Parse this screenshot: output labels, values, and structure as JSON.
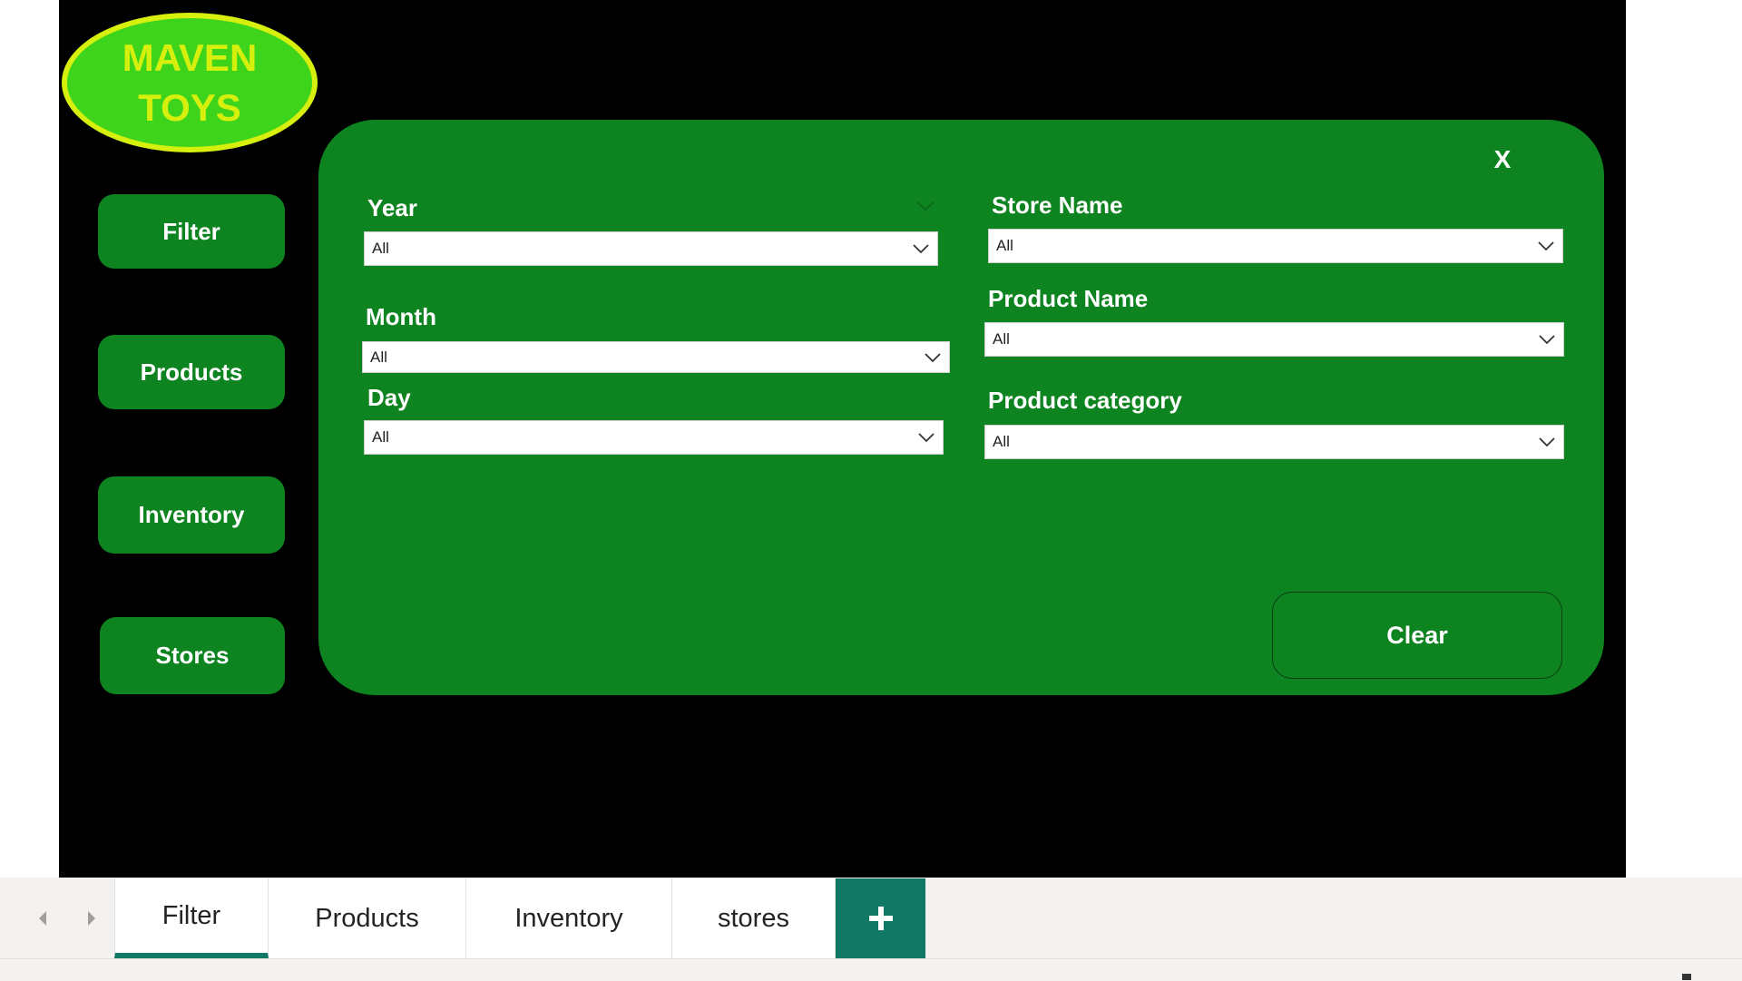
{
  "logo": {
    "line1": "MAVEN",
    "line2": "TOYS"
  },
  "nav": {
    "filter_label": "Filter",
    "products_label": "Products",
    "inventory_label": "Inventory",
    "stores_label": "Stores"
  },
  "panel": {
    "close_label": "X",
    "clear_label": "Clear"
  },
  "slicers": {
    "year": {
      "label": "Year",
      "value": "All"
    },
    "month": {
      "label": "Month",
      "value": "All"
    },
    "day": {
      "label": "Day",
      "value": "All"
    },
    "store_name": {
      "label": "Store Name",
      "value": "All"
    },
    "product_name": {
      "label": "Product Name",
      "value": "All"
    },
    "product_category": {
      "label": "Product category",
      "value": "All"
    }
  },
  "tabs": [
    {
      "label": "Filter",
      "active": true
    },
    {
      "label": "Products",
      "active": false
    },
    {
      "label": "Inventory",
      "active": false
    },
    {
      "label": "stores",
      "active": false
    }
  ],
  "icons": {
    "prev_page": "chevron-left-icon",
    "next_page": "chevron-right-icon",
    "add_page": "plus-icon",
    "dropdown": "chevron-down-icon",
    "close": "close-icon"
  },
  "colors": {
    "canvas": "#000000",
    "panel_green": "#0e8421",
    "logo_fill": "#3fd41c",
    "logo_accent": "#d6ef0c",
    "tab_accent": "#117865"
  }
}
